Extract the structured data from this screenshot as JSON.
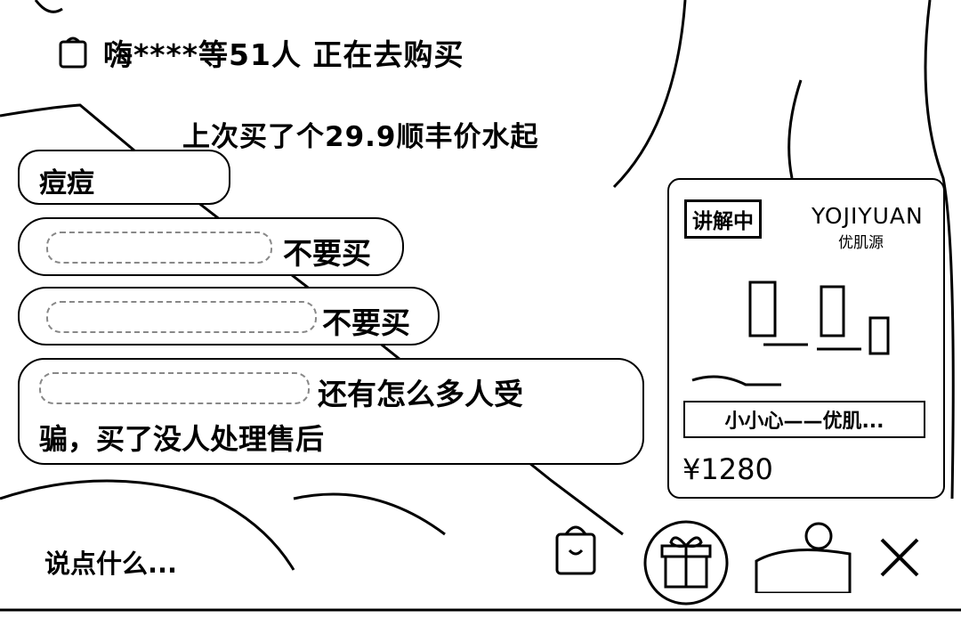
{
  "banner": {
    "icon": "shopping-bag-icon",
    "text": "嗨****等51人 正在去购买"
  },
  "comments": [
    {
      "text": "上次买了个29.9顺丰价水起",
      "text_line2": "痘痘"
    },
    {
      "text": "不要买"
    },
    {
      "text": "不要买"
    },
    {
      "text": "还有怎么多人受",
      "text_line2": "骗，买了没人处理售后"
    }
  ],
  "product": {
    "badge": "讲解中",
    "brand": "YOJIYUAN",
    "brand_cn": "优肌源",
    "caption": "小小心——优肌...",
    "price": "¥1280"
  },
  "bottom": {
    "input_placeholder": "说点什么...",
    "icons": [
      "shopping-bag-icon",
      "gift-icon",
      "user-icon",
      "close-icon"
    ]
  }
}
